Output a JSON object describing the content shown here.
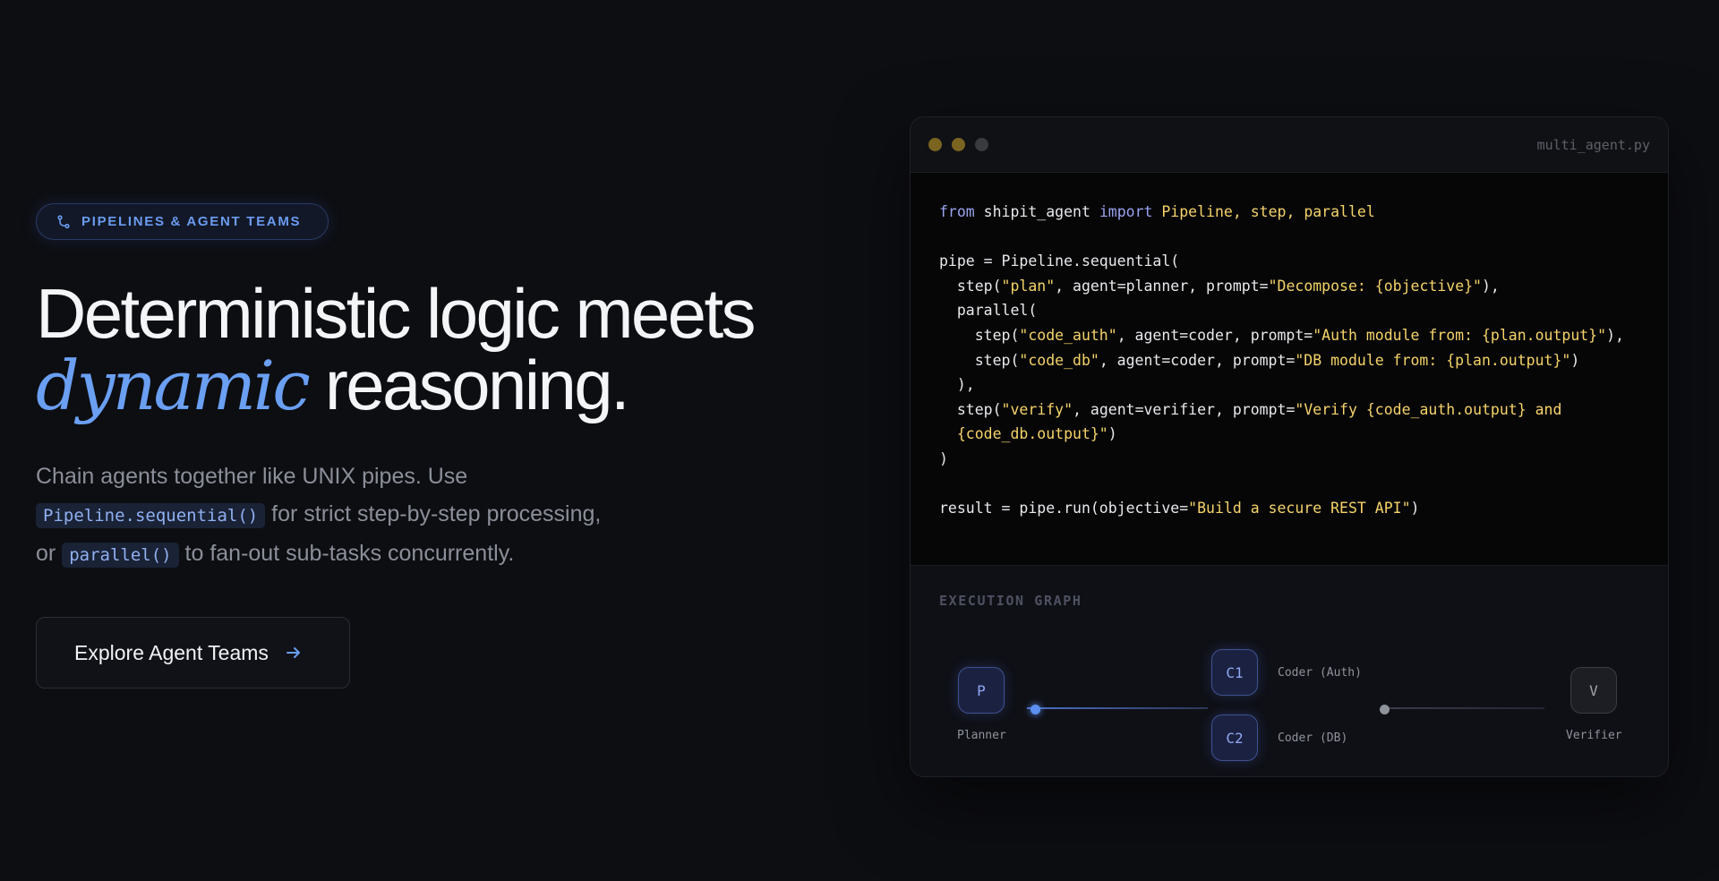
{
  "badge": {
    "label": "PIPELINES & AGENT TEAMS",
    "icon": "git-branch-icon"
  },
  "headline": {
    "line1": "Deterministic logic meets",
    "accent": "dynamic",
    "line2_rest": " reasoning."
  },
  "description": {
    "part1": "Chain agents together like UNIX pipes. Use",
    "code1": "Pipeline.sequential()",
    "part2": " for strict step-by-step processing,",
    "part3": "or ",
    "code2": "parallel()",
    "part4": " to fan-out sub-tasks concurrently."
  },
  "cta": {
    "label": "Explore Agent Teams",
    "icon": "arrow-right-icon"
  },
  "colors": {
    "accent": "#6a9ff2",
    "string": "#f5d36a",
    "keyword": "#9aa3f0",
    "background": "#0d0e12"
  },
  "code_window": {
    "filename": "multi_agent.py",
    "traffic_lights": [
      "#7a6420",
      "#7a6420",
      "#3a3b3e"
    ],
    "lines": [
      [
        [
          "kw",
          "from"
        ],
        [
          "txt",
          " shipit_agent "
        ],
        [
          "kw",
          "import"
        ],
        [
          "str",
          " Pipeline, step, parallel"
        ]
      ],
      [],
      [
        [
          "txt",
          "pipe = Pipeline.sequential("
        ]
      ],
      [
        [
          "txt",
          "  step("
        ],
        [
          "str",
          "\"plan\""
        ],
        [
          "txt",
          ", agent=planner, prompt="
        ],
        [
          "str",
          "\"Decompose: {objective}\""
        ],
        [
          "txt",
          "),"
        ]
      ],
      [
        [
          "txt",
          "  parallel("
        ]
      ],
      [
        [
          "txt",
          "    step("
        ],
        [
          "str",
          "\"code_auth\""
        ],
        [
          "txt",
          ", agent=coder, prompt="
        ],
        [
          "str",
          "\"Auth module from: {plan.output}\""
        ],
        [
          "txt",
          "),"
        ]
      ],
      [
        [
          "txt",
          "    step("
        ],
        [
          "str",
          "\"code_db\""
        ],
        [
          "txt",
          ", agent=coder, prompt="
        ],
        [
          "str",
          "\"DB module from: {plan.output}\""
        ],
        [
          "txt",
          ")"
        ]
      ],
      [
        [
          "txt",
          "  ),"
        ]
      ],
      [
        [
          "txt",
          "  step("
        ],
        [
          "str",
          "\"verify\""
        ],
        [
          "txt",
          ", agent=verifier, prompt="
        ],
        [
          "str",
          "\"Verify {code_auth.output} and"
        ]
      ],
      [
        [
          "str",
          "  {code_db.output}\""
        ],
        [
          "txt",
          ")"
        ]
      ],
      [
        [
          "txt",
          ")"
        ]
      ],
      [],
      [
        [
          "txt",
          "result = pipe.run(objective="
        ],
        [
          "str",
          "\"Build a secure REST API\""
        ],
        [
          "txt",
          ")"
        ]
      ]
    ]
  },
  "execution_graph": {
    "title": "EXECUTION GRAPH",
    "nodes": [
      {
        "id": "P",
        "label": "Planner"
      },
      {
        "id": "C1",
        "label": "Coder (Auth)"
      },
      {
        "id": "C2",
        "label": "Coder (DB)"
      },
      {
        "id": "V",
        "label": "Verifier"
      }
    ]
  }
}
